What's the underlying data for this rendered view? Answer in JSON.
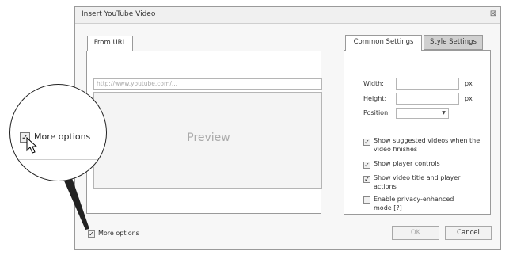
{
  "dialog": {
    "title": "Insert YouTube Video",
    "close_glyph": "⊠"
  },
  "left_tabs": [
    {
      "label": "From URL",
      "active": true
    }
  ],
  "url_input": {
    "placeholder": "http://www.youtube.com/..."
  },
  "preview": {
    "label": "Preview"
  },
  "right_tabs": [
    {
      "label": "Common Settings",
      "active": true
    },
    {
      "label": "Style Settings",
      "active": false
    }
  ],
  "fields": {
    "width": {
      "label": "Width:",
      "unit": "px"
    },
    "height": {
      "label": "Height:",
      "unit": "px"
    },
    "position": {
      "label": "Position:"
    }
  },
  "options": [
    {
      "label": "Show suggested videos when the video finishes",
      "checked": true
    },
    {
      "label": "Show player controls",
      "checked": true
    },
    {
      "label": "Show video title and player actions",
      "checked": true
    },
    {
      "label": "Enable privacy-enhanced mode [?]",
      "checked": false
    }
  ],
  "more_options": {
    "label": "More options",
    "checked": true
  },
  "buttons": {
    "ok": "OK",
    "cancel": "Cancel"
  },
  "magnifier": {
    "label": "More options",
    "checked": true
  }
}
